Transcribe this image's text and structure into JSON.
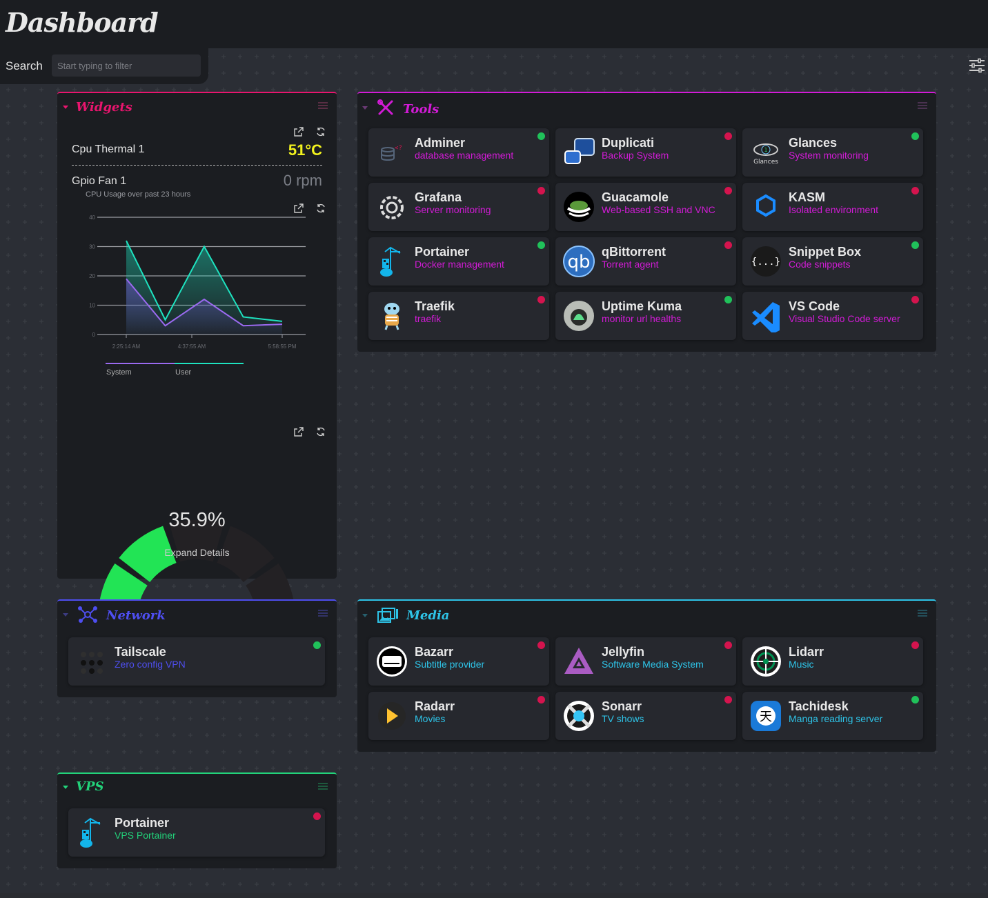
{
  "header": {
    "title": "Dashboard"
  },
  "search": {
    "label": "Search",
    "placeholder": "Start typing to filter"
  },
  "colors": {
    "up": "#20c15a",
    "down": "#d4144e",
    "widgets": "#e8156e",
    "tools": "#d21bd6",
    "network": "#4e4ef0",
    "media": "#2ec4e8",
    "vps": "#22d27a"
  },
  "widgets": {
    "title": "Widgets",
    "cpu_thermal": {
      "label": "Cpu Thermal 1",
      "value": "51°C"
    },
    "gpio_fan": {
      "label": "Gpio Fan 1",
      "value": "0 rpm"
    },
    "chart_title": "CPU Usage over past 23 hours",
    "gauge": {
      "value": "35.9%",
      "fraction": 0.359,
      "expand": "Expand Details"
    }
  },
  "chart_data": {
    "type": "area",
    "title": "CPU Usage over past 23 hours",
    "x": [
      "2:25:14 AM",
      "",
      "4:37:55 AM",
      "",
      "",
      "5:58:55 PM"
    ],
    "xticks": [
      "2:25:14 AM",
      "4:37:55 AM",
      "5:58:55 PM"
    ],
    "ylim": [
      0,
      40
    ],
    "yticks": [
      0,
      10,
      20,
      30,
      40
    ],
    "series": [
      {
        "name": "System",
        "color": "#9b6af0",
        "values": [
          19,
          3,
          12,
          3,
          3.5
        ]
      },
      {
        "name": "User",
        "color": "#1ee3c0",
        "values": [
          32,
          5,
          30,
          6,
          4.5
        ]
      }
    ],
    "legend": "bottom-left"
  },
  "tools": {
    "title": "Tools",
    "items": [
      {
        "name": "Adminer",
        "desc": "database management",
        "status": "up",
        "icon": "database-icon"
      },
      {
        "name": "Duplicati",
        "desc": "Backup System",
        "status": "down",
        "icon": "duplicati-icon"
      },
      {
        "name": "Glances",
        "desc": "System monitoring",
        "status": "up",
        "icon": "glances-icon",
        "icon_text": "Glances"
      },
      {
        "name": "Grafana",
        "desc": "Server monitoring",
        "status": "down",
        "icon": "grafana-icon"
      },
      {
        "name": "Guacamole",
        "desc": "Web-based SSH and VNC",
        "status": "down",
        "icon": "guacamole-icon"
      },
      {
        "name": "KASM",
        "desc": "Isolated environment",
        "status": "down",
        "icon": "kasm-icon"
      },
      {
        "name": "Portainer",
        "desc": "Docker management",
        "status": "up",
        "icon": "portainer-icon"
      },
      {
        "name": "qBittorrent",
        "desc": "Torrent agent",
        "status": "down",
        "icon": "qbittorrent-icon",
        "icon_text": "qb"
      },
      {
        "name": "Snippet Box",
        "desc": "Code snippets",
        "status": "up",
        "icon": "snippet-box-icon",
        "icon_text": "{...}"
      },
      {
        "name": "Traefik",
        "desc": "traefik",
        "status": "down",
        "icon": "traefik-icon"
      },
      {
        "name": "Uptime Kuma",
        "desc": "monitor url healths",
        "status": "up",
        "icon": "uptime-kuma-icon"
      },
      {
        "name": "VS Code",
        "desc": "Visual Studio Code server",
        "status": "down",
        "icon": "vscode-icon"
      }
    ]
  },
  "network": {
    "title": "Network",
    "items": [
      {
        "name": "Tailscale",
        "desc": "Zero config VPN",
        "status": "up",
        "icon": "tailscale-icon"
      }
    ]
  },
  "media": {
    "title": "Media",
    "items": [
      {
        "name": "Bazarr",
        "desc": "Subtitle provider",
        "status": "down",
        "icon": "bazarr-icon"
      },
      {
        "name": "Jellyfin",
        "desc": "Software Media System",
        "status": "down",
        "icon": "jellyfin-icon"
      },
      {
        "name": "Lidarr",
        "desc": "Music",
        "status": "down",
        "icon": "lidarr-icon"
      },
      {
        "name": "Radarr",
        "desc": "Movies",
        "status": "down",
        "icon": "radarr-icon"
      },
      {
        "name": "Sonarr",
        "desc": "TV shows",
        "status": "down",
        "icon": "sonarr-icon"
      },
      {
        "name": "Tachidesk",
        "desc": "Manga reading server",
        "status": "up",
        "icon": "tachidesk-icon"
      }
    ]
  },
  "vps": {
    "title": "VPS",
    "items": [
      {
        "name": "Portainer",
        "desc": "VPS Portainer",
        "status": "down",
        "icon": "portainer-icon"
      }
    ]
  }
}
